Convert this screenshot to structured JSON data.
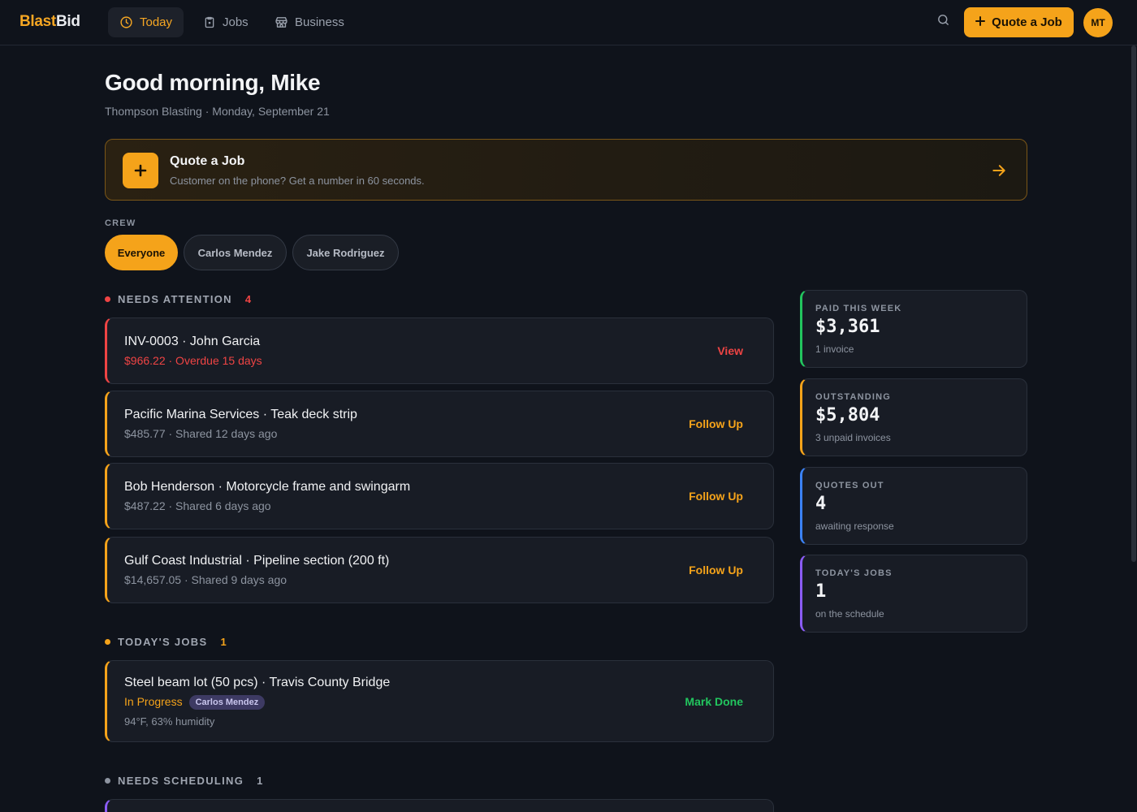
{
  "brand": {
    "part1": "Blast",
    "part2": "Bid"
  },
  "nav": {
    "tabs": [
      {
        "label": "Today",
        "icon": "clock-icon"
      },
      {
        "label": "Jobs",
        "icon": "clipboard-icon"
      },
      {
        "label": "Business",
        "icon": "storefront-icon"
      }
    ],
    "quote_button": "Quote a Job",
    "avatar": "MT"
  },
  "greeting": {
    "title": "Good morning, Mike",
    "subtitle": "Thompson Blasting · Monday, September 21"
  },
  "quote_card": {
    "title": "Quote a Job",
    "subtitle": "Customer on the phone? Get a number in 60 seconds."
  },
  "crew": {
    "label": "CREW",
    "chips": [
      "Everyone",
      "Carlos Mendez",
      "Jake Rodriguez"
    ],
    "selected": "Everyone"
  },
  "needs_attention": {
    "label": "NEEDS ATTENTION",
    "count": "4",
    "items": [
      {
        "title": "INV-0003 · John Garcia",
        "subtitle": "$966.22 · Overdue 15 days",
        "action": "View"
      },
      {
        "title": "Pacific Marina Services · Teak deck strip",
        "subtitle": "$485.77 · Shared 12 days ago",
        "action": "Follow Up"
      },
      {
        "title": "Bob Henderson · Motorcycle frame and swingarm",
        "subtitle": "$487.22 · Shared 6 days ago",
        "action": "Follow Up"
      },
      {
        "title": "Gulf Coast Industrial · Pipeline section (200 ft)",
        "subtitle": "$14,657.05 · Shared 9 days ago",
        "action": "Follow Up"
      }
    ]
  },
  "todays_jobs": {
    "label": "TODAY'S JOBS",
    "count": "1",
    "items": [
      {
        "title": "Steel beam lot (50 pcs) · Travis County Bridge",
        "status": "In Progress",
        "crew": "Carlos Mendez",
        "weather": "94°F, 63% humidity",
        "action": "Mark Done"
      }
    ]
  },
  "needs_scheduling": {
    "label": "NEEDS SCHEDULING",
    "count": "1"
  },
  "stats": [
    {
      "label": "PAID THIS WEEK",
      "value": "$3,361",
      "note": "1 invoice",
      "color": "#22c55e"
    },
    {
      "label": "OUTSTANDING",
      "value": "$5,804",
      "note": "3 unpaid invoices",
      "color": "#f5a31a"
    },
    {
      "label": "QUOTES OUT",
      "value": "4",
      "note": "awaiting response",
      "color": "#3b82f6"
    },
    {
      "label": "TODAY'S JOBS",
      "value": "1",
      "note": "on the schedule",
      "color": "#8b5cf6"
    }
  ],
  "colors": {
    "accent": "#f5a31a",
    "danger": "#ef4444",
    "success": "#22c55e",
    "purple": "#8b5cf6",
    "gray_dot": "#8d94a0"
  }
}
